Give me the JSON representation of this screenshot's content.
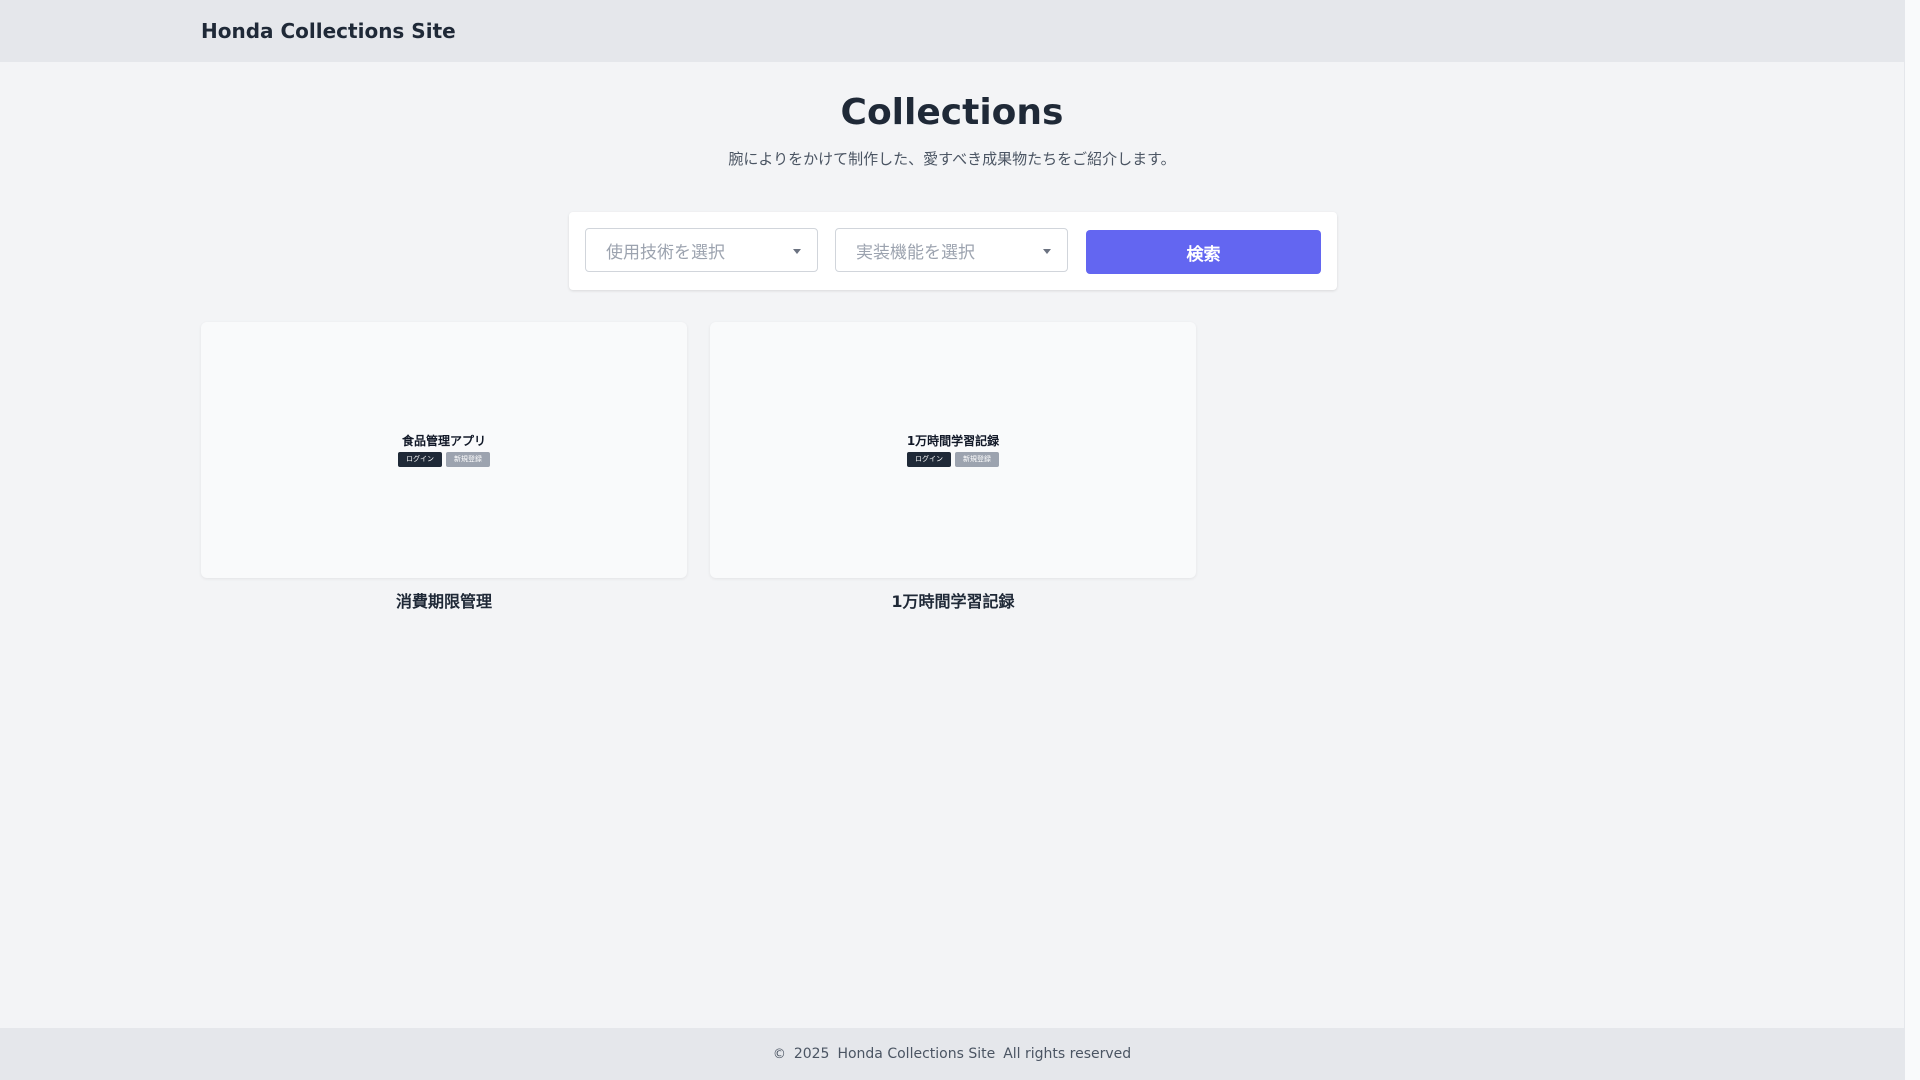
{
  "header": {
    "site_title": "Honda Collections Site"
  },
  "hero": {
    "title": "Collections",
    "subtitle": "腕によりをかけて制作した、愛すべき成果物たちをご紹介します。"
  },
  "search": {
    "technology_placeholder": "使用技術を選択",
    "feature_placeholder": "実装機能を選択",
    "button_label": "検索"
  },
  "collections": [
    {
      "name": "消費期限管理",
      "thumbnail": {
        "title": "食品管理アプリ",
        "buttons": [
          "ログイン",
          "新規登録"
        ]
      }
    },
    {
      "name": "1万時間学習記録",
      "thumbnail": {
        "title": "1万時間学習記録",
        "buttons": [
          "ログイン",
          "新規登録"
        ]
      }
    }
  ],
  "footer": {
    "copyright_symbol": "©",
    "year": "2025",
    "site_name": "Honda Collections Site",
    "rights": "All rights reserved"
  },
  "colors": {
    "accent": "#6366f1",
    "header_bg": "#e5e7eb",
    "page_bg": "#f3f4f6"
  }
}
